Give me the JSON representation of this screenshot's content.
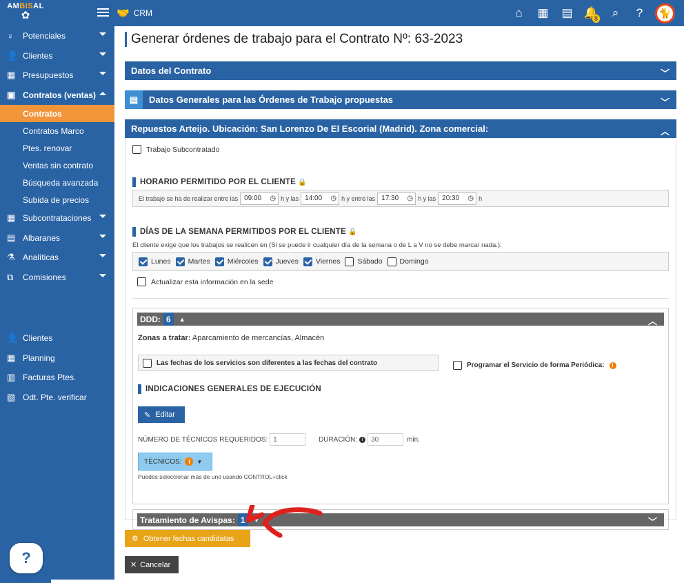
{
  "brand": {
    "logo_text_1": "AM",
    "logo_text_2": "BIS",
    "logo_text_3": "AL",
    "crm_label": "CRM"
  },
  "topbar": {
    "notifications_count": "8"
  },
  "sidebar": {
    "items": [
      {
        "label": "Potenciales"
      },
      {
        "label": "Clientes"
      },
      {
        "label": "Presupuestos"
      },
      {
        "label": "Contratos (ventas)"
      }
    ],
    "sub_items": [
      {
        "label": "Contratos"
      },
      {
        "label": "Contratos Marco"
      },
      {
        "label": "Ptes. renovar"
      },
      {
        "label": "Ventas sin contrato"
      },
      {
        "label": "Búsqueda avanzada"
      },
      {
        "label": "Subida de precios"
      }
    ],
    "items2": [
      {
        "label": "Subcontrataciones"
      },
      {
        "label": "Albaranes"
      },
      {
        "label": "Analíticas"
      },
      {
        "label": "Comisiones"
      }
    ],
    "items3": [
      {
        "label": "Clientes"
      },
      {
        "label": "Planning"
      },
      {
        "label": "Facturas Ptes."
      },
      {
        "label": "Odt. Pte. verificar"
      }
    ],
    "help": "?"
  },
  "main": {
    "title": "Generar órdenes de trabajo para el Contrato Nº: 63-2023",
    "bar1": "Datos del Contrato",
    "bar2": "Datos Generales para las Órdenes de Trabajo propuestas",
    "bar3": "Repuestos Arteijo. Ubicación: San Lorenzo De El Escorial (Madrid). Zona comercial:",
    "subcontratado": "Trabajo Subcontratado",
    "horario": {
      "title": "HORARIO PERMITIDO POR EL CLIENTE",
      "t1": "El trabajo se ha de realizar entre las",
      "v1": "09:00",
      "t2": "h y las",
      "v2": "14:00",
      "t3": "h y entre las",
      "v3": "17:30",
      "t4": "h y las",
      "v4": "20:30",
      "t5": "h"
    },
    "dias": {
      "title": "DÍAS DE LA SEMANA PERMITIDOS POR EL CLIENTE",
      "note": "El cliente exige que los trabajos se realicen en (Si se puede ir cualquier día de la semana o de L a V no se debe marcar nada.):",
      "days": [
        "Lunes",
        "Martes",
        "Miércoles",
        "Jueves",
        "Viernes",
        "Sábado",
        "Domingo"
      ],
      "actualizar": "Actualizar esta información en la sede"
    },
    "ddd": {
      "label": "DDD:",
      "count": "6",
      "zonas_label": "Zonas a tratar:",
      "zonas_value": "Aparcamiento de mercancías, Almacén",
      "fechas_dif": "Las fechas de los servicios son diferentes a las fechas del contrato",
      "programar": "Programar el Servicio de forma Periódica:",
      "indicaciones": "INDICACIONES GENERALES DE EJECUCIÓN",
      "editar": "Editar",
      "num_tecnicos_label": "NÚMERO DE TÉCNICOS REQUERIDOS:",
      "num_tecnicos_value": "1",
      "duracion_label": "DURACIÓN:",
      "duracion_value": "30",
      "duracion_unit": "min.",
      "tecnicos": "TÉCNICOS:",
      "hint": "Puedes seleccionar más de uno usando CONTROL+click"
    },
    "avispas": {
      "label": "Tratamiento de Avispas:",
      "count": "1"
    },
    "obtener": "Obtener fechas candidatas",
    "cancelar": "Cancelar"
  }
}
